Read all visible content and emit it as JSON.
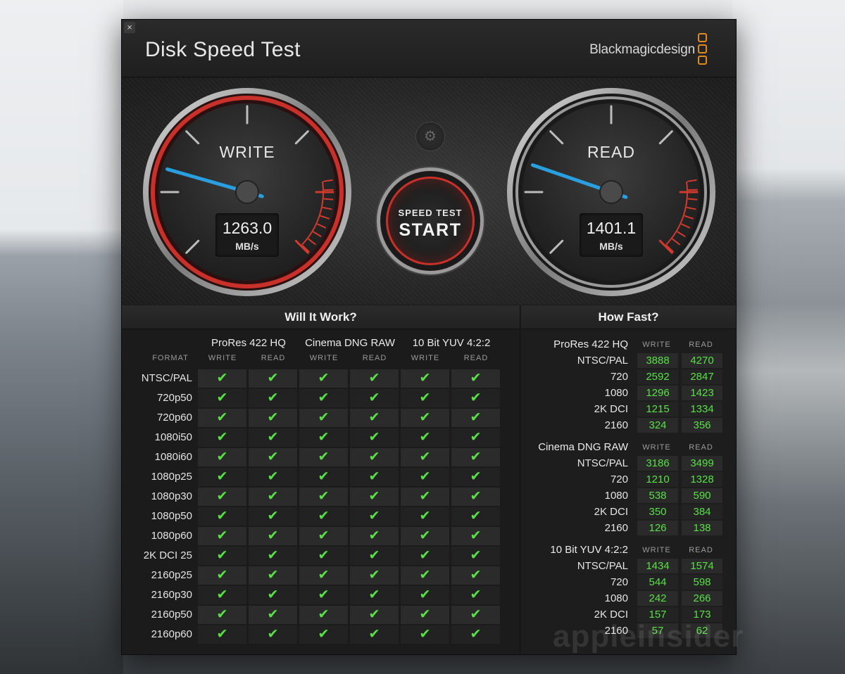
{
  "window": {
    "title": "Disk Speed Test",
    "brand": "Blackmagicdesign",
    "close_label": "×"
  },
  "colors": {
    "accent_red": "#c8312a",
    "needle_blue": "#2a9fe0",
    "check_green": "#58e046",
    "logo_orange": "#e08a1e"
  },
  "gauges": {
    "write": {
      "label": "WRITE",
      "value": "1263.0",
      "unit": "MB/s"
    },
    "read": {
      "label": "READ",
      "value": "1401.1",
      "unit": "MB/s"
    }
  },
  "start_button": {
    "small": "SPEED TEST",
    "big": "START"
  },
  "settings_icon": "gear-icon",
  "will_it_work": {
    "title": "Will It Work?",
    "format_label": "FORMAT",
    "codecs": [
      "ProRes 422 HQ",
      "Cinema DNG RAW",
      "10 Bit YUV 4:2:2"
    ],
    "write_label": "WRITE",
    "read_label": "READ",
    "check": "✔",
    "formats": [
      "NTSC/PAL",
      "720p50",
      "720p60",
      "1080i50",
      "1080i60",
      "1080p25",
      "1080p30",
      "1080p50",
      "1080p60",
      "2K DCI 25",
      "2160p25",
      "2160p30",
      "2160p50",
      "2160p60"
    ]
  },
  "how_fast": {
    "title": "How Fast?",
    "write_label": "WRITE",
    "read_label": "READ",
    "groups": [
      {
        "name": "ProRes 422 HQ",
        "rows": [
          {
            "fmt": "NTSC/PAL",
            "w": "3888",
            "r": "4270"
          },
          {
            "fmt": "720",
            "w": "2592",
            "r": "2847"
          },
          {
            "fmt": "1080",
            "w": "1296",
            "r": "1423"
          },
          {
            "fmt": "2K DCI",
            "w": "1215",
            "r": "1334"
          },
          {
            "fmt": "2160",
            "w": "324",
            "r": "356"
          }
        ]
      },
      {
        "name": "Cinema DNG RAW",
        "rows": [
          {
            "fmt": "NTSC/PAL",
            "w": "3186",
            "r": "3499"
          },
          {
            "fmt": "720",
            "w": "1210",
            "r": "1328"
          },
          {
            "fmt": "1080",
            "w": "538",
            "r": "590"
          },
          {
            "fmt": "2K DCI",
            "w": "350",
            "r": "384"
          },
          {
            "fmt": "2160",
            "w": "126",
            "r": "138"
          }
        ]
      },
      {
        "name": "10 Bit YUV 4:2:2",
        "rows": [
          {
            "fmt": "NTSC/PAL",
            "w": "1434",
            "r": "1574"
          },
          {
            "fmt": "720",
            "w": "544",
            "r": "598"
          },
          {
            "fmt": "1080",
            "w": "242",
            "r": "266"
          },
          {
            "fmt": "2K DCI",
            "w": "157",
            "r": "173"
          },
          {
            "fmt": "2160",
            "w": "57",
            "r": "62"
          }
        ]
      }
    ]
  },
  "watermark": "appleinsider"
}
